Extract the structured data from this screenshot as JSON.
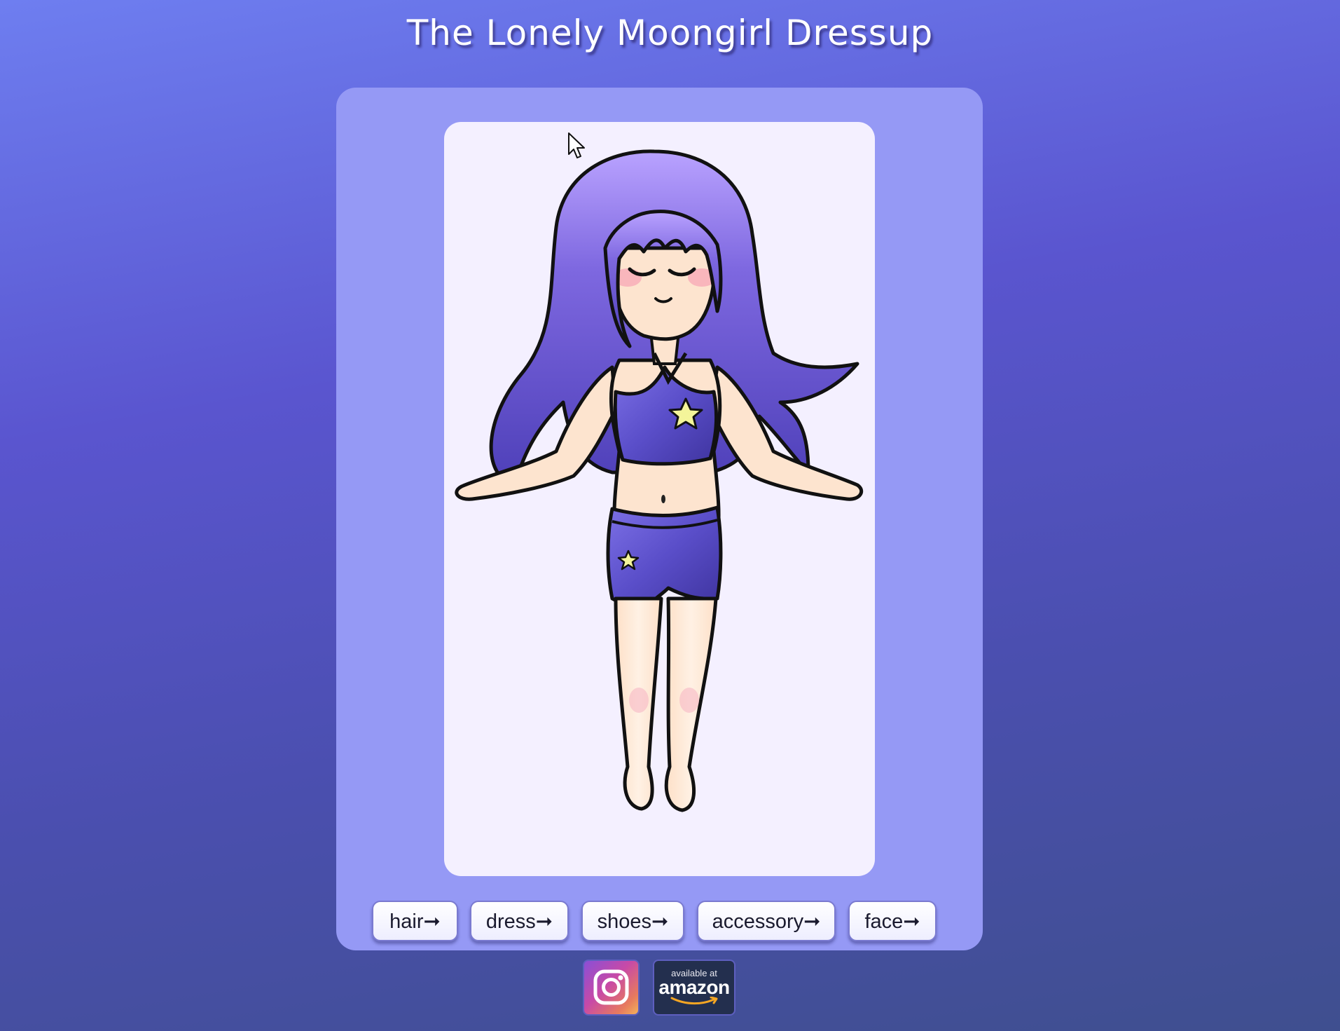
{
  "page": {
    "title": "The Lonely Moongirl Dressup"
  },
  "stage": {
    "character": "moongirl-figure"
  },
  "buttons": {
    "hair": "hair➞",
    "dress": "dress➞",
    "shoes": "shoes➞",
    "accessory": "accessory➞",
    "face": "face➞"
  },
  "footer": {
    "instagram_icon": "instagram-icon",
    "amazon_small": "available at",
    "amazon_big": "amazon"
  },
  "colors": {
    "background_top": "#6e7ef0",
    "background_bottom": "#3f4f8f",
    "panel": "#9599f5",
    "stage": "#f4f0ff",
    "hair": "#6a5ad6",
    "outfit": "#5a4fc8",
    "star": "#f4f59a",
    "skin": "#fde4cf"
  }
}
